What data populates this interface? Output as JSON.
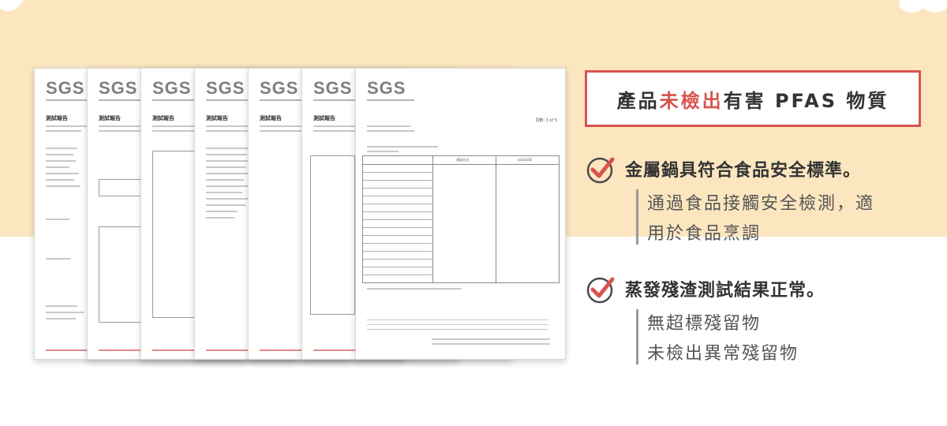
{
  "headline": {
    "prefix": "產品",
    "highlight": "未檢出",
    "suffix": "有害 PFAS 物質"
  },
  "features": [
    {
      "heading": "金屬鍋具符合食品安全標準。",
      "lines": [
        "通過食品接觸安全檢測，適",
        "用於食品烹調"
      ]
    },
    {
      "heading": "蒸發殘渣測試結果正常。",
      "lines": [
        "無超標殘留物",
        "未檢出異常殘留物"
      ]
    }
  ],
  "documents": [
    {
      "logo": "SGS",
      "title": "測試報告"
    },
    {
      "logo": "SGS",
      "title": "測試報告"
    },
    {
      "logo": "SGS",
      "title": "測試報告"
    },
    {
      "logo": "SGS",
      "title": "測試報告"
    },
    {
      "logo": "SGS",
      "title": "測試報告"
    },
    {
      "logo": "SGS",
      "title": "測試報告"
    },
    {
      "logo": "SGS",
      "title": ""
    }
  ],
  "front_doc": {
    "page": "頁數: 3 of 5",
    "col_method": "測試方法",
    "col_loq": "LOQ/LOD"
  },
  "colors": {
    "accent": "#d9534f",
    "band": "#fbe6c0",
    "text": "#333333"
  }
}
